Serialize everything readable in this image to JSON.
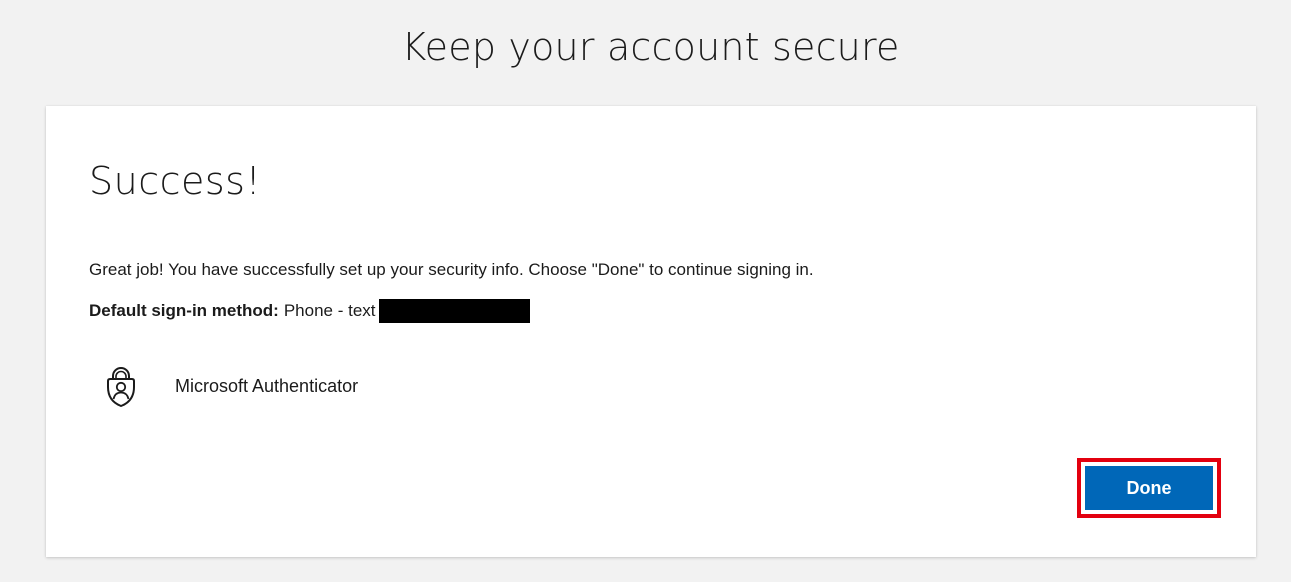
{
  "page": {
    "title": "Keep your account secure"
  },
  "card": {
    "heading": "Success!",
    "message": "Great job! You have successfully set up your security info. Choose \"Done\" to continue signing in.",
    "default_method_label": "Default sign-in method:",
    "default_method_value": "Phone - text",
    "method": {
      "icon": "authenticator-lock-icon",
      "label": "Microsoft Authenticator"
    },
    "done_label": "Done"
  },
  "colors": {
    "background": "#f2f2f2",
    "card": "#ffffff",
    "primary_button": "#0067b8",
    "highlight_border": "#e3000f",
    "text": "#1b1b1b"
  }
}
